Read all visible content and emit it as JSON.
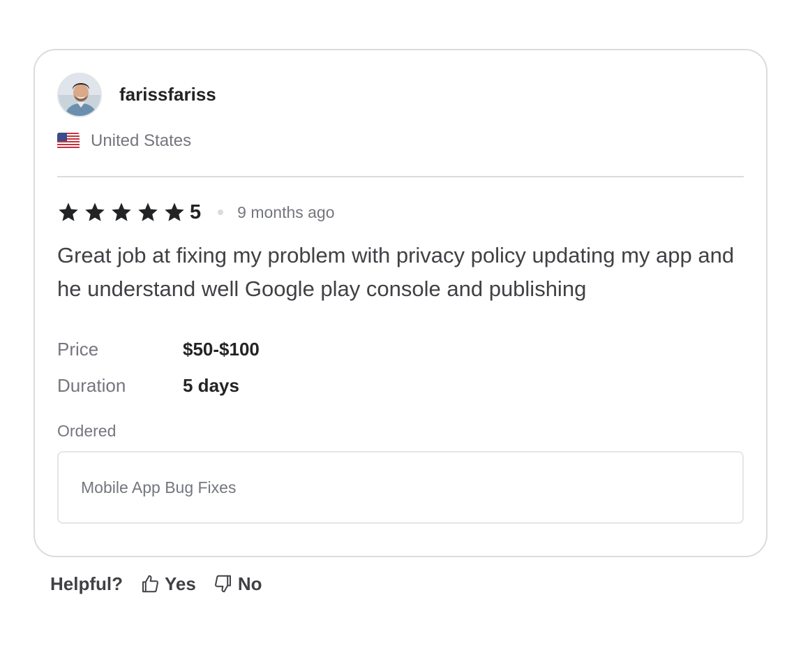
{
  "reviewer": {
    "username": "farissfariss",
    "country": "United States",
    "flag_icon": "us-flag-icon",
    "avatar_icon": "user-avatar"
  },
  "review": {
    "stars": 5,
    "rating": "5",
    "time_ago": "9 months ago",
    "text": "Great job at fixing my problem with privacy policy updating my app and he understand well Google play console and publishing",
    "star_color": "#222325"
  },
  "details": {
    "price_label": "Price",
    "price_value": "$50-$100",
    "duration_label": "Duration",
    "duration_value": "5 days"
  },
  "ordered": {
    "label": "Ordered",
    "gig": "Mobile App Bug Fixes"
  },
  "helpful": {
    "label": "Helpful?",
    "yes_label": "Yes",
    "no_label": "No",
    "yes_icon": "thumbs-up-icon",
    "no_icon": "thumbs-down-icon"
  },
  "colors": {
    "text_primary": "#222325",
    "text_secondary": "#74767e",
    "border": "#dadbdd"
  }
}
